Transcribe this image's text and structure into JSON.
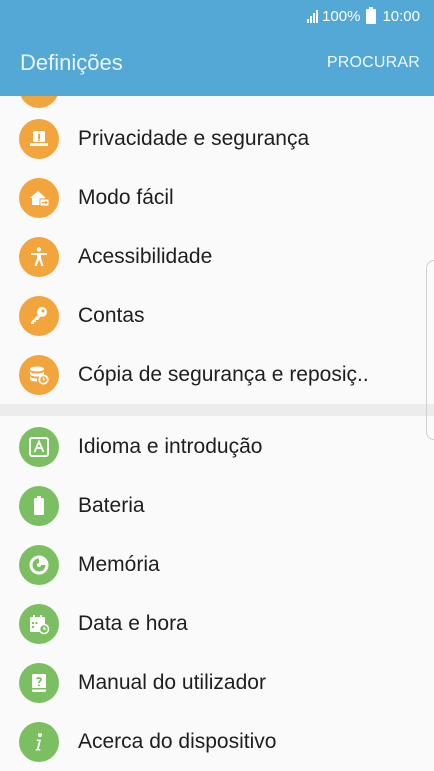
{
  "status": {
    "battery": "100%",
    "time": "10:00"
  },
  "header": {
    "title": "Definições",
    "search_label": "PROCURAR"
  },
  "items": [
    {
      "label": "Privacidade e segurança",
      "icon": "privacy-icon"
    },
    {
      "label": "Modo fácil",
      "icon": "easy-mode-icon"
    },
    {
      "label": "Acessibilidade",
      "icon": "accessibility-icon"
    },
    {
      "label": "Contas",
      "icon": "accounts-key-icon"
    },
    {
      "label": "Cópia de segurança e reposiç..",
      "icon": "backup-reset-icon"
    },
    {
      "label": "Idioma e introdução",
      "icon": "language-input-icon"
    },
    {
      "label": "Bateria",
      "icon": "battery-icon"
    },
    {
      "label": "Memória",
      "icon": "memory-icon"
    },
    {
      "label": "Data e hora",
      "icon": "date-time-icon"
    },
    {
      "label": "Manual do utilizador",
      "icon": "user-manual-icon"
    },
    {
      "label": "Acerca do dispositivo",
      "icon": "about-device-icon"
    }
  ],
  "colors": {
    "header": "#53a8d6",
    "orange_icon": "#f2a53c",
    "green_icon": "#7cbf63"
  }
}
